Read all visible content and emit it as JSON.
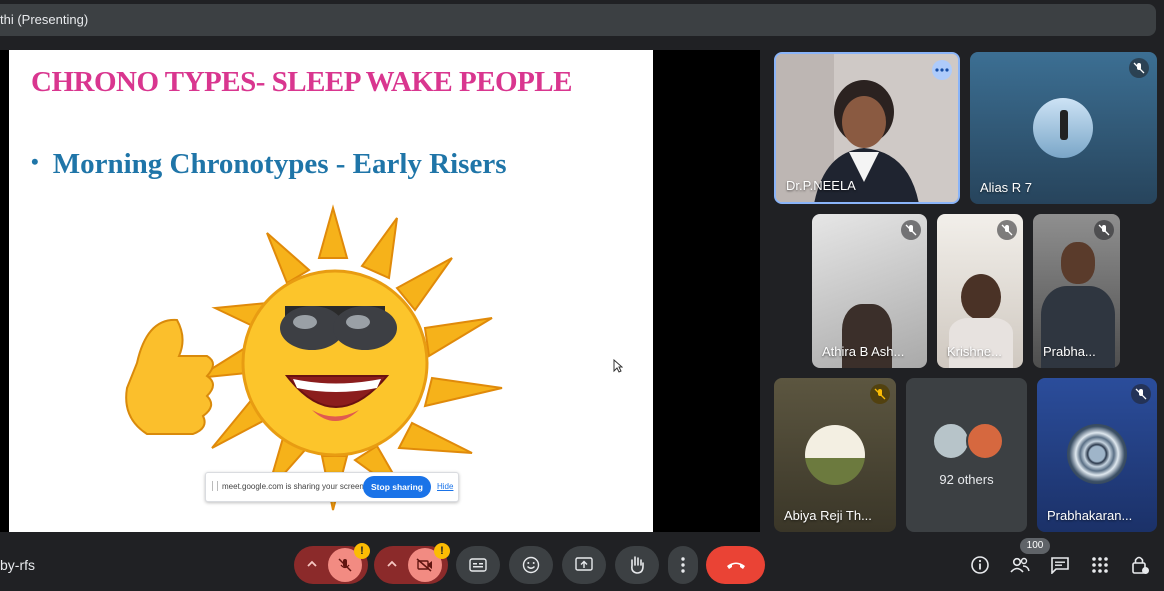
{
  "meeting": {
    "presenter_label": "thi (Presenting)",
    "meeting_code": "by-rfs"
  },
  "slide": {
    "title": "CHRONO TYPES- SLEEP WAKE PEOPLE",
    "bullet": "Morning Chronotypes - Early Risers",
    "title_color": "#d9368f",
    "bullet_color": "#1f75a8"
  },
  "share_bar": {
    "message": "meet.google.com is sharing your screen.",
    "stop_label": "Stop sharing",
    "hide_label": "Hide"
  },
  "participants": [
    {
      "name": "Dr.P.NEELA",
      "icon": "more-options-icon"
    },
    {
      "name": "Alias R 7",
      "icon": "mic-off-icon"
    },
    {
      "name": "Athira B Ash...",
      "icon": "mic-off-icon"
    },
    {
      "name": "Krishne...",
      "icon": "mic-off-icon"
    },
    {
      "name": "Prabha...",
      "icon": "mic-off-icon"
    },
    {
      "name": "Abiya Reji Th...",
      "icon": "mic-off-icon"
    },
    {
      "name": "Prabhakaran...",
      "icon": "mic-off-icon"
    }
  ],
  "others": {
    "label": "92 others"
  },
  "toolbar": {
    "warning_mark": "!",
    "participant_count": "100",
    "end_call_color": "#ea4335",
    "muted_bg": "#f28b82"
  }
}
